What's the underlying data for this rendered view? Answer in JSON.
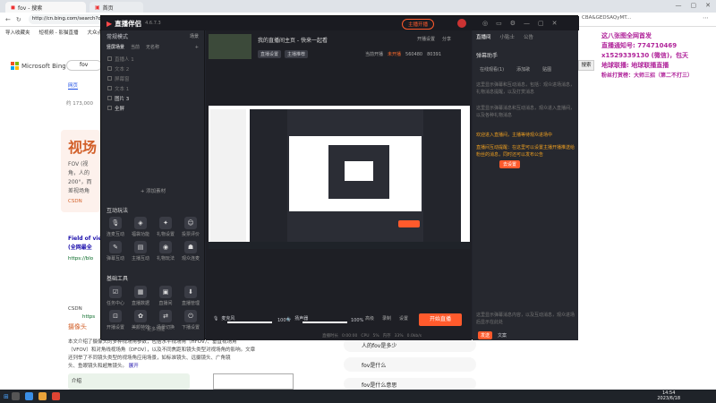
{
  "browser": {
    "tabs": [
      "fov - 搜索",
      "首页"
    ],
    "url": "http://cn.bing.com/search?q=fov",
    "url_tail": "CBA&GEDSAQyMT...",
    "bookmarks": [
      "导入收藏夹",
      "短视频 - 影猫直播",
      "大众点..."
    ]
  },
  "bing": {
    "logo": "Microsoft Bing",
    "query": "fov",
    "search_btn": "搜索",
    "tabs": [
      "网页"
    ],
    "result_count": "约 173,000",
    "snippet_title": "视场",
    "snippet_lines": [
      "FOV (视",
      "角，人的",
      "200°，而",
      "差视场角"
    ],
    "csdn": "CSDN",
    "field_of_view": "Field of vie",
    "quanwei": "(全网最全",
    "https": "https://blo",
    "csdn2": "CSDN",
    "https2": "https",
    "sheying": "摄像头",
    "body_lines": [
      "本文介绍了摄像头的多种视场角参数，包括水平视场角（HFOV）、垂直视场角",
      "（VFOV）和对角线视场角（DFOV），以及不同焦距和镜头类型对视场角的影响。文章",
      "还列举了不同镜头类型的视场角应用场景，如标准镜头、远摄镜头、广角镜",
      "头、鱼眼镜头和超焦镜头。"
    ],
    "expand": "展开",
    "outline": "介绍",
    "related": [
      "人的fov是多少",
      "fov是什么",
      "fov是什么意思"
    ]
  },
  "app": {
    "title": "直播伴侣",
    "version": "4.6.7.3",
    "status_pill": "主播开播",
    "scene_mode": "常规模式",
    "scene_btn": "场景",
    "tabs": [
      "竖屏场景",
      "当前",
      "无名称"
    ],
    "sources": [
      "直播人 1",
      "文本 2",
      "屏幕窗",
      "文本 1",
      "图片 3",
      "全屏"
    ],
    "add_source": "+ 添加素材",
    "interaction_title": "互动玩法",
    "interaction_items": [
      "连麦互动",
      "福袋功能",
      "礼物设置",
      "投票评价",
      "弹幕互动",
      "主播互动",
      "礼物玩法",
      "观众连麦"
    ],
    "tools_title": "基础工具",
    "tools_items": [
      "任务中心",
      "直播数据",
      "直播间",
      "直播管理",
      "开播设置",
      "美颜特效",
      "场景切换",
      "下播设置"
    ],
    "more": "... 更多功能",
    "room_title": "我的直播间主页 - 快来一起看",
    "room_meta1": "直播设置",
    "room_meta2": "主播推荐",
    "room_actions": [
      "开播设置",
      "分享"
    ],
    "stats": [
      "当前开播",
      "未开播",
      "560480",
      "80391"
    ],
    "top_buttons": [
      "开播设置",
      "分享"
    ],
    "mic_label": "麦克风",
    "mic_value": "100%",
    "speaker_label": "扬声器",
    "speaker_value": "100%",
    "bottom_icons": [
      "高级",
      "录制",
      "设置"
    ],
    "start_button": "开始直播",
    "footer": [
      "直播时长",
      "0:00:00",
      "CPU",
      "5%",
      "内存",
      "33%",
      "0.0kb/s"
    ],
    "right_tabs": [
      "直播间",
      "小贴士",
      "公告"
    ],
    "assistant": "弹幕助手",
    "assistant_tabs": [
      "在线观看(1)",
      "添加歌",
      "贴图"
    ],
    "hint1": "这里显示弹幕和互动消息，包括：观众进场消息，礼物消息提醒，以及打赏消息",
    "hint2": "这里显示弹幕消息和互动消息，观众进入直播间，以及各种礼物消息",
    "notice_title": "欢迎进入直播间，主播等待观众进场中",
    "notice_body": "直播间互动提醒：在这里可以设置主播开播推送给粉丝的消息，同时还可以发布公告",
    "notice_btn": "去设置",
    "bottom_hint": "这里显示弹幕消息内容，以及互动消息，观众进场后显示在此处",
    "send_label": "发送",
    "chat_label": "文案"
  },
  "overlay": {
    "lines": [
      "这八张图全网首发",
      "直播通知号: 774710469",
      "x1529339130 (微信)，包天",
      "地球联播: 地球联播直播",
      "粉丝打赏榜：大师三招（第二不打三）"
    ]
  },
  "taskbar": {
    "time": "14:54",
    "date": "2023/6/18"
  }
}
